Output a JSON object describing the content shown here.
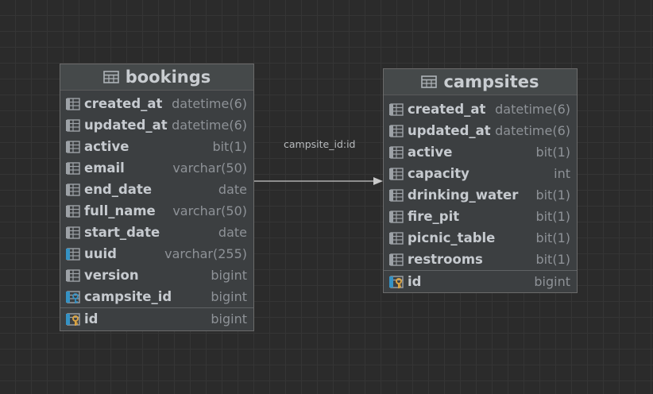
{
  "tables": [
    {
      "name": "bookings",
      "columns": [
        {
          "name": "created_at",
          "type": "datetime(6)",
          "kind": "column"
        },
        {
          "name": "updated_at",
          "type": "datetime(6)",
          "kind": "column"
        },
        {
          "name": "active",
          "type": "bit(1)",
          "kind": "column"
        },
        {
          "name": "email",
          "type": "varchar(50)",
          "kind": "column"
        },
        {
          "name": "end_date",
          "type": "date",
          "kind": "column"
        },
        {
          "name": "full_name",
          "type": "varchar(50)",
          "kind": "column"
        },
        {
          "name": "start_date",
          "type": "date",
          "kind": "column"
        },
        {
          "name": "uuid",
          "type": "varchar(255)",
          "kind": "indexed-column"
        },
        {
          "name": "version",
          "type": "bigint",
          "kind": "column"
        },
        {
          "name": "campsite_id",
          "type": "bigint",
          "kind": "foreign-key"
        }
      ],
      "primary_key": {
        "name": "id",
        "type": "bigint",
        "kind": "primary-key"
      }
    },
    {
      "name": "campsites",
      "columns": [
        {
          "name": "created_at",
          "type": "datetime(6)",
          "kind": "column"
        },
        {
          "name": "updated_at",
          "type": "datetime(6)",
          "kind": "column"
        },
        {
          "name": "active",
          "type": "bit(1)",
          "kind": "column"
        },
        {
          "name": "capacity",
          "type": "int",
          "kind": "column"
        },
        {
          "name": "drinking_water",
          "type": "bit(1)",
          "kind": "column"
        },
        {
          "name": "fire_pit",
          "type": "bit(1)",
          "kind": "column"
        },
        {
          "name": "picnic_table",
          "type": "bit(1)",
          "kind": "column"
        },
        {
          "name": "restrooms",
          "type": "bit(1)",
          "kind": "column"
        }
      ],
      "primary_key": {
        "name": "id",
        "type": "bigint",
        "kind": "primary-key"
      }
    }
  ],
  "relationship": {
    "label": "campsite_id:id",
    "from": "bookings.campsite_id",
    "to": "campsites.id"
  },
  "colors": {
    "canvas": "#2b2b2b",
    "table_body": "#3c3f41",
    "table_header": "#45494a",
    "column_name": "#c6cacf",
    "column_type": "#8e9297",
    "key_gold": "#d9a343",
    "fk_blue": "#3592c4"
  }
}
